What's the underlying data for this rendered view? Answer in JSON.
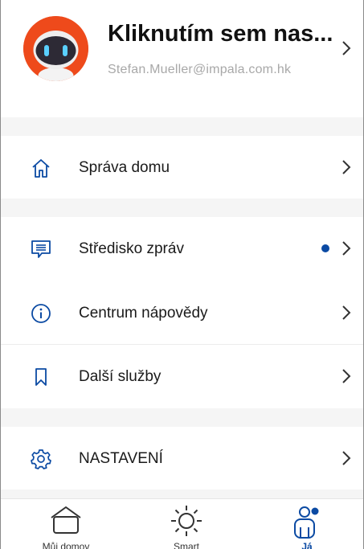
{
  "colors": {
    "accent": "#0b4aa3",
    "avatar": "#ee4a1b",
    "background": "#f5f5f5"
  },
  "profile": {
    "name": "Kliknutím sem nas...",
    "email": "Stefan.Mueller@impala.com.hk",
    "avatar_icon": "robot-avatar-icon"
  },
  "menu": {
    "home_management": {
      "label": "Správa domu",
      "icon": "house-icon"
    },
    "message_center": {
      "label": "Středisko zpráv",
      "icon": "message-icon",
      "unread": true
    },
    "help_center": {
      "label": "Centrum nápovědy",
      "icon": "info-icon"
    },
    "more_services": {
      "label": "Další služby",
      "icon": "bookmark-icon"
    },
    "settings": {
      "label": "NASTAVENÍ",
      "icon": "gear-icon"
    }
  },
  "tabbar": {
    "items": [
      {
        "label": "Můj domov",
        "icon": "home-tab-icon",
        "active": false
      },
      {
        "label": "Smart",
        "icon": "sun-icon",
        "active": false
      },
      {
        "label": "Já",
        "icon": "person-icon",
        "active": true
      }
    ]
  }
}
